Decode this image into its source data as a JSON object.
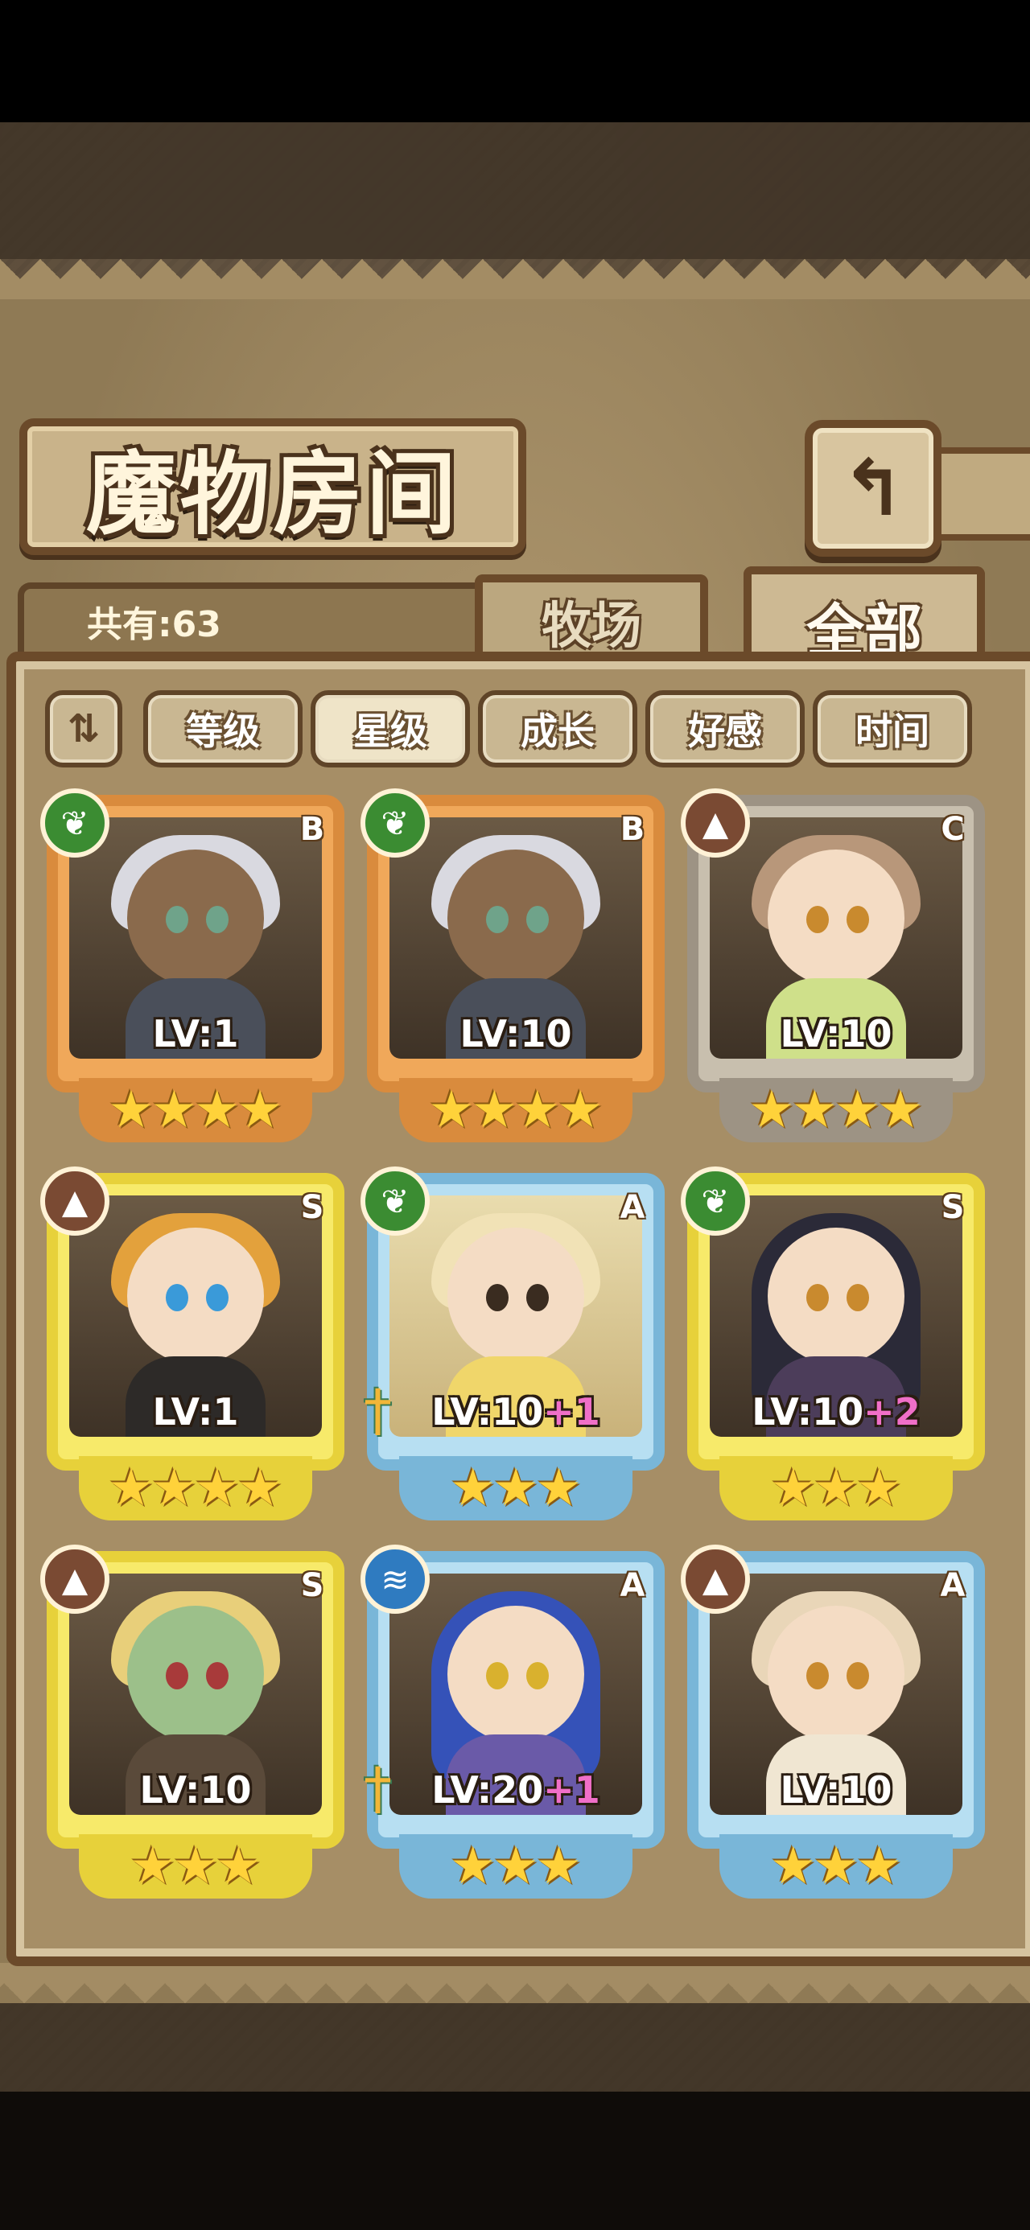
{
  "title": "魔物房间",
  "back_icon": "back-arrow-icon",
  "count_text": "共有:63",
  "tabs": {
    "ranch": "牧场",
    "all": "全部"
  },
  "sort": {
    "toggle_icon": "sort-toggle-icon",
    "buttons": [
      "等级",
      "星级",
      "成长",
      "好感",
      "时间"
    ],
    "active": "星级"
  },
  "cards": [
    {
      "rank": "B",
      "element": "plant",
      "level": "LV:1",
      "bonus": "",
      "stars": 4,
      "weapon": false
    },
    {
      "rank": "B",
      "element": "plant",
      "level": "LV:10",
      "bonus": "",
      "stars": 4,
      "weapon": false
    },
    {
      "rank": "C",
      "element": "earth",
      "level": "LV:10",
      "bonus": "",
      "stars": 4,
      "weapon": false
    },
    {
      "rank": "S",
      "element": "earth",
      "level": "LV:1",
      "bonus": "",
      "stars": 4,
      "weapon": false
    },
    {
      "rank": "A",
      "element": "plant",
      "level": "LV:10",
      "bonus": "+1",
      "stars": 3,
      "weapon": true
    },
    {
      "rank": "S",
      "element": "plant",
      "level": "LV:10",
      "bonus": "+2",
      "stars": 3,
      "weapon": false
    },
    {
      "rank": "S",
      "element": "earth",
      "level": "LV:10",
      "bonus": "",
      "stars": 3,
      "weapon": false
    },
    {
      "rank": "A",
      "element": "water",
      "level": "LV:20",
      "bonus": "+1",
      "stars": 3,
      "weapon": true
    },
    {
      "rank": "A",
      "element": "earth",
      "level": "LV:10",
      "bonus": "",
      "stars": 3,
      "weapon": false
    }
  ]
}
